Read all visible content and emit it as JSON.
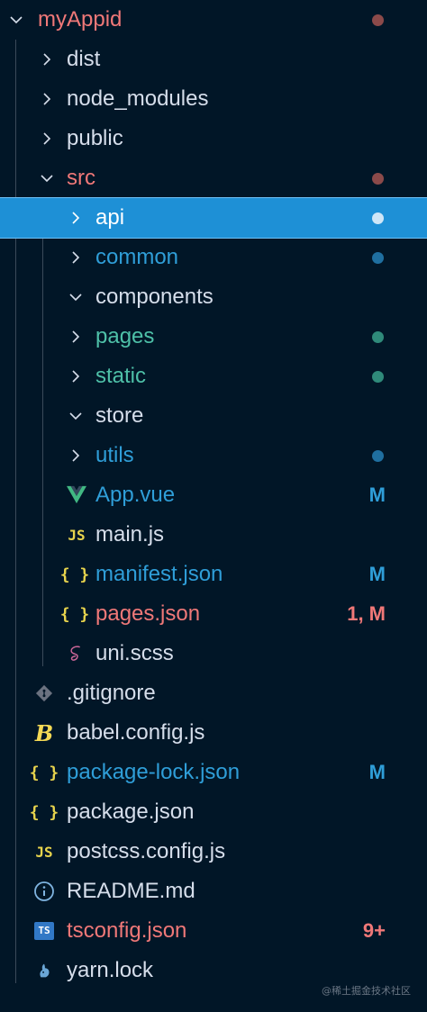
{
  "colors": {
    "background": "#011627",
    "selected_bg": "#1e90d6",
    "red": "#f07878",
    "blue": "#2f9ed8",
    "teal": "#4ec0a8",
    "default_text": "#d6deeb",
    "dot_red": "#8b4a4a",
    "dot_blue": "#1f6fa0",
    "dot_teal": "#2f8a7a",
    "dot_white": "#cfe6f7"
  },
  "explorer": {
    "root": {
      "label": "myAppid"
    },
    "items": [
      {
        "label": "dist"
      },
      {
        "label": "node_modules"
      },
      {
        "label": "public"
      },
      {
        "label": "src"
      },
      {
        "label": "api"
      },
      {
        "label": "common"
      },
      {
        "label": "components"
      },
      {
        "label": "pages"
      },
      {
        "label": "static"
      },
      {
        "label": "store"
      },
      {
        "label": "utils"
      },
      {
        "label": "App.vue",
        "badge": "M",
        "icon": "vue-icon"
      },
      {
        "label": "main.js",
        "icon_text": "JS"
      },
      {
        "label": "manifest.json",
        "badge": "M",
        "icon_text": "{ }"
      },
      {
        "label": "pages.json",
        "badge": "1, M",
        "icon_text": "{ }"
      },
      {
        "label": "uni.scss",
        "icon": "sass-icon"
      },
      {
        "label": ".gitignore",
        "icon": "git-icon"
      },
      {
        "label": "babel.config.js",
        "icon": "babel-icon"
      },
      {
        "label": "package-lock.json",
        "badge": "M",
        "icon_text": "{ }"
      },
      {
        "label": "package.json",
        "icon_text": "{ }"
      },
      {
        "label": "postcss.config.js",
        "icon_text": "JS"
      },
      {
        "label": "README.md",
        "icon": "info-icon"
      },
      {
        "label": "tsconfig.json",
        "badge": "9+",
        "icon_text": "TS"
      },
      {
        "label": "yarn.lock",
        "icon": "yarn-icon"
      }
    ]
  },
  "watermark": "@稀土掘金技术社区"
}
